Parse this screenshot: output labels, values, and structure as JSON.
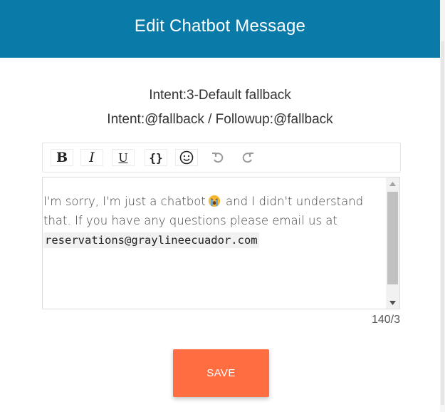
{
  "header": {
    "title": "Edit Chatbot Message"
  },
  "intent": {
    "line1": "Intent:3-Default fallback",
    "line2": "Intent:@fallback / Followup:@fallback"
  },
  "toolbar": {
    "bold_label": "B",
    "italic_label": "I",
    "underline_label": "U",
    "code_label": "{}",
    "buttons": [
      {
        "name": "bold",
        "icon": "bold-icon"
      },
      {
        "name": "italic",
        "icon": "italic-icon"
      },
      {
        "name": "underline",
        "icon": "underline-icon"
      },
      {
        "name": "code",
        "icon": "code-braces-icon"
      },
      {
        "name": "emoji",
        "icon": "smiley-icon"
      },
      {
        "name": "undo",
        "icon": "undo-icon"
      },
      {
        "name": "redo",
        "icon": "redo-icon"
      }
    ]
  },
  "editor": {
    "text_before_emoji": "I'm sorry, I'm just a chatbot",
    "emoji": "crying-face-emoji",
    "text_after_emoji": " and I didn't understand that. If you have any questions please email us at ",
    "email": "reservations@graylineecuador.com"
  },
  "counter": "140/3",
  "save_button": {
    "label": "SAVE"
  },
  "colors": {
    "header_bg": "#0a7ba8",
    "save_bg": "#ff6e40",
    "text": "#444444"
  }
}
